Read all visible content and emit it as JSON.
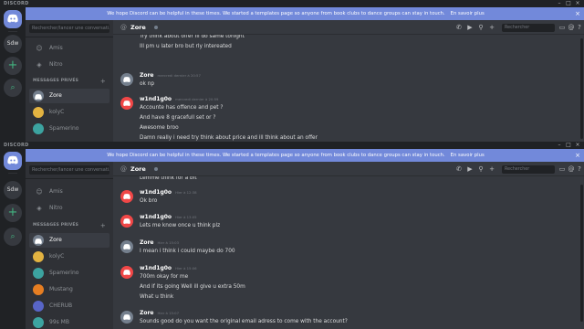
{
  "app": {
    "title": "DISCORD"
  },
  "window_controls": {
    "minimize": "–",
    "maximize": "□",
    "close": "×"
  },
  "servers": {
    "user_label": "Sdw",
    "add": "+",
    "explore": "⌕"
  },
  "banner": {
    "text": "We hope Discord can be helpful in these times. We started a templates page so anyone from book clubs to dance groups can stay in touch.",
    "link": "En savoir plus",
    "close": "×"
  },
  "dm_panel": {
    "search_placeholder": "Rechercher/lancer une conversati...",
    "nav": [
      {
        "label": "Amis",
        "icon": "friends-icon"
      },
      {
        "label": "Nitro",
        "icon": "nitro-icon"
      }
    ],
    "section_title": "MESSAGES PRIVÉS",
    "section_add": "+"
  },
  "dms_top": [
    {
      "name": "Zore",
      "avatar": "#747f8d",
      "selected": true
    },
    {
      "name": "kolyC",
      "avatar": "#e3b341",
      "selected": false
    },
    {
      "name": "Spamerino",
      "avatar": "#3ca3a0",
      "selected": false
    }
  ],
  "dms_bottom": [
    {
      "name": "Zore",
      "avatar": "#747f8d",
      "selected": true
    },
    {
      "name": "kolyC",
      "avatar": "#e3b341",
      "selected": false
    },
    {
      "name": "Spamerino",
      "avatar": "#3ca3a0",
      "selected": false
    },
    {
      "name": "Mustang",
      "avatar": "#e67e22",
      "selected": false
    },
    {
      "name": "CHERUB",
      "avatar": "#5865c7",
      "selected": false
    },
    {
      "name": "99s MB",
      "avatar": "#3ca3a0",
      "selected": false
    }
  ],
  "chat": {
    "channel_icon": "@",
    "recipient": "Zore",
    "search_placeholder": "Rechercher",
    "header_icons": [
      "phone-call-icon",
      "video-call-icon",
      "pin-icon",
      "add-user-icon",
      "inbox-icon",
      "mention-icon",
      "help-icon"
    ]
  },
  "top_messages": {
    "groups": [
      {
        "lines": [
          "Try think about offer Ill do same tonight",
          "Ill pm u later bro but rly intereated"
        ]
      },
      {
        "author": "Zore",
        "time": "mercredi dernier à 20:57",
        "avatar": "#747f8d",
        "lines": [
          "ok np"
        ]
      },
      {
        "author": "w1nd1g0o",
        "time": "mercredi dernier à 20:59",
        "avatar": "#f04747",
        "lines": [
          "Accounte has offence and pet ?",
          "And have 8 gracefull set or ?",
          "Awesome broo",
          "Damn really i need try think about price and ill think about an offer"
        ]
      }
    ]
  },
  "bottom_messages": {
    "groups": [
      {
        "lines": [
          "Lemme think for a bit"
        ]
      },
      {
        "author": "w1nd1g0o",
        "time": "Hier à 12:38",
        "avatar": "#f04747",
        "lines": [
          "Ok bro"
        ]
      },
      {
        "author": "w1nd1g0o",
        "time": "Hier à 13:05",
        "avatar": "#f04747",
        "lines": [
          "Lets me know  once u think plz"
        ]
      },
      {
        "author": "Zore",
        "time": "Hier à 15:03",
        "avatar": "#747f8d",
        "lines": [
          "I mean i think i could maybe do 700"
        ]
      },
      {
        "author": "w1nd1g0o",
        "time": "Hier à 15:06",
        "avatar": "#f04747",
        "lines": [
          "700m okay for me",
          "And if its going Well ill give u extra 50m",
          "What u think"
        ]
      },
      {
        "author": "Zore",
        "time": "Hier à 15:07",
        "avatar": "#747f8d",
        "lines": [
          "Sounds good do you want the original email adress to come with the account?"
        ]
      }
    ]
  }
}
